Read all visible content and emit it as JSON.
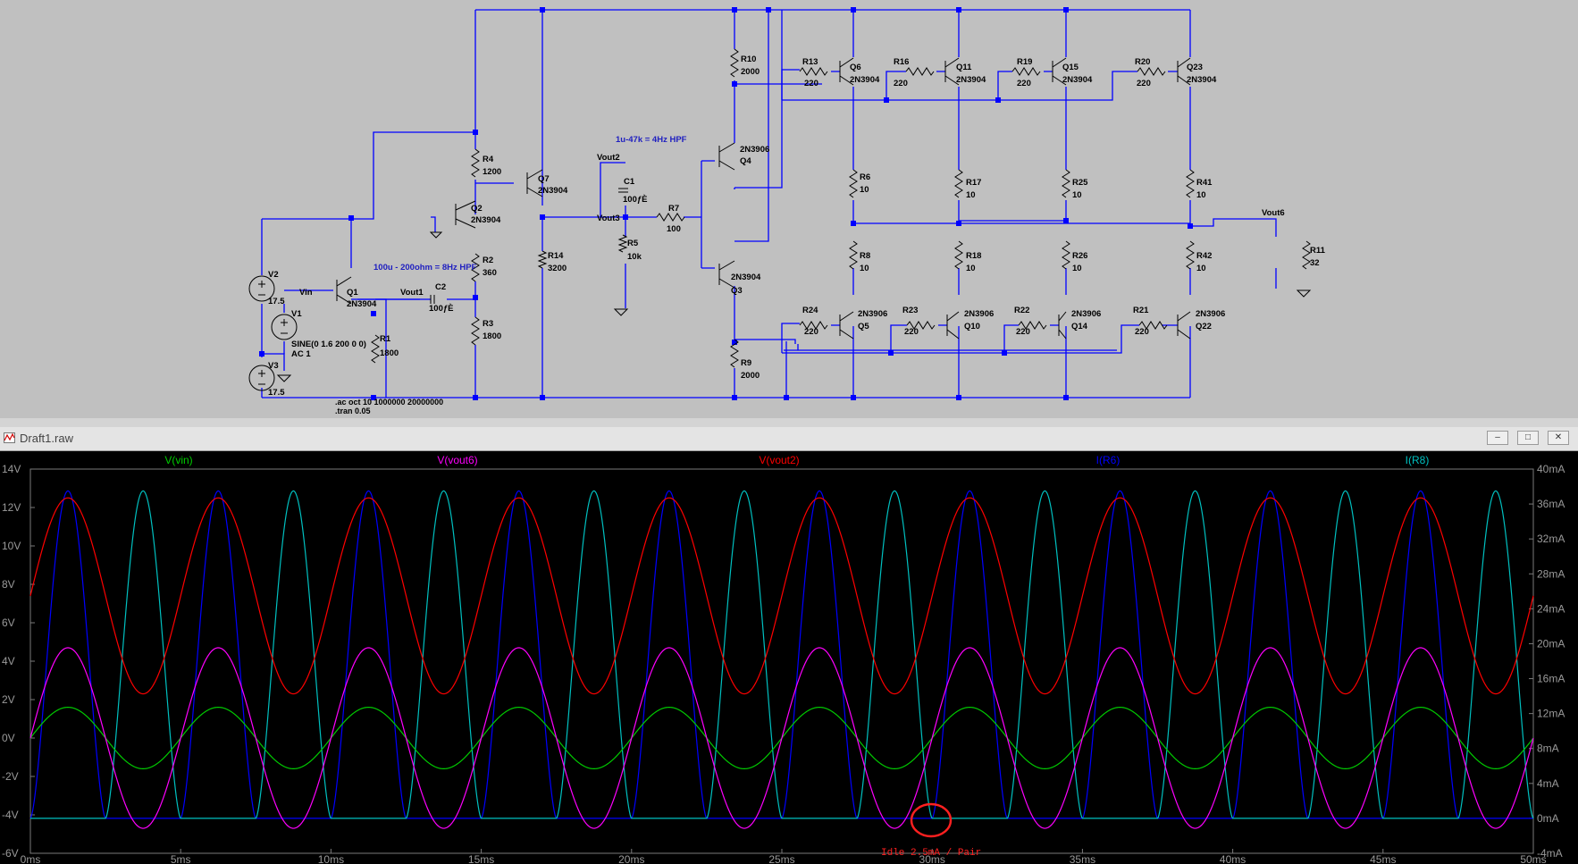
{
  "schematic": {
    "components": [
      {
        "ref": "V2",
        "value": "17.5"
      },
      {
        "ref": "V3",
        "value": "17.5"
      },
      {
        "ref": "V1",
        "value": "SINE(0 1.6 200 0 0)",
        "ac": "AC 1"
      },
      {
        "ref": "Q1",
        "value": "2N3904"
      },
      {
        "ref": "Q2",
        "value": "2N3904"
      },
      {
        "ref": "Q7",
        "value": "2N3904"
      },
      {
        "ref": "Q4",
        "value": "2N3906"
      },
      {
        "ref": "Q3",
        "value": "2N3904"
      },
      {
        "ref": "Q6",
        "value": "2N3904"
      },
      {
        "ref": "Q11",
        "value": "2N3904"
      },
      {
        "ref": "Q15",
        "value": "2N3904"
      },
      {
        "ref": "Q23",
        "value": "2N3904"
      },
      {
        "ref": "Q5",
        "value": "2N3906"
      },
      {
        "ref": "Q10",
        "value": "2N3906"
      },
      {
        "ref": "Q14",
        "value": "2N3906"
      },
      {
        "ref": "Q22",
        "value": "2N3906"
      },
      {
        "ref": "R1",
        "value": "1800"
      },
      {
        "ref": "R2",
        "value": "360"
      },
      {
        "ref": "R3",
        "value": "1800"
      },
      {
        "ref": "R4",
        "value": "1200"
      },
      {
        "ref": "R5",
        "value": "10k"
      },
      {
        "ref": "R7",
        "value": "100"
      },
      {
        "ref": "R14",
        "value": "3200"
      },
      {
        "ref": "R10",
        "value": "2000"
      },
      {
        "ref": "R9",
        "value": "2000"
      },
      {
        "ref": "R13",
        "value": "220"
      },
      {
        "ref": "R16",
        "value": "220"
      },
      {
        "ref": "R19",
        "value": "220"
      },
      {
        "ref": "R20",
        "value": "220"
      },
      {
        "ref": "R24",
        "value": "220"
      },
      {
        "ref": "R23",
        "value": "220"
      },
      {
        "ref": "R22",
        "value": "220"
      },
      {
        "ref": "R21",
        "value": "220"
      },
      {
        "ref": "R6",
        "value": "10"
      },
      {
        "ref": "R8",
        "value": "10"
      },
      {
        "ref": "R17",
        "value": "10"
      },
      {
        "ref": "R18",
        "value": "10"
      },
      {
        "ref": "R25",
        "value": "10"
      },
      {
        "ref": "R26",
        "value": "10"
      },
      {
        "ref": "R41",
        "value": "10"
      },
      {
        "ref": "R42",
        "value": "10"
      },
      {
        "ref": "R11",
        "value": "32"
      },
      {
        "ref": "C1",
        "value": "100ƒÈ"
      },
      {
        "ref": "C2",
        "value": "100ƒÈ"
      }
    ],
    "nets": {
      "vin": "Vin",
      "vout1": "Vout1",
      "vout2": "Vout2",
      "vout3": "Vout3",
      "vout6": "Vout6"
    },
    "notes": {
      "hpf2": "100u - 200ohm = 8Hz HPF",
      "hpf1": "1u-47k = 4Hz HPF"
    },
    "directives": {
      "ac": ".ac oct 10 1000000 20000000",
      "tran": ".tran 0.05"
    },
    "wire_color": "#0000ff"
  },
  "plot_window": {
    "title": "Draft1.raw",
    "buttons": {
      "minimize": "–",
      "maximize": "□",
      "close": "✕"
    },
    "traces": [
      {
        "label": "V(vin)",
        "color": "#00cc00"
      },
      {
        "label": "V(vout6)",
        "color": "#ff00ff"
      },
      {
        "label": "V(vout2)",
        "color": "#ff0000"
      },
      {
        "label": "I(R6)",
        "color": "#0000ff"
      },
      {
        "label": "I(R8)",
        "color": "#00c0c0"
      }
    ],
    "left_axis_ticks": [
      "14V",
      "12V",
      "10V",
      "8V",
      "6V",
      "4V",
      "2V",
      "0V",
      "-2V",
      "-4V",
      "-6V"
    ],
    "right_axis_ticks": [
      "40mA",
      "36mA",
      "32mA",
      "28mA",
      "24mA",
      "20mA",
      "16mA",
      "12mA",
      "8mA",
      "4mA",
      "0mA",
      "-4mA"
    ],
    "x_axis_ticks": [
      "0ms",
      "5ms",
      "10ms",
      "15ms",
      "20ms",
      "25ms",
      "30ms",
      "35ms",
      "40ms",
      "45ms",
      "50ms"
    ],
    "annotation": "Idle 2.5mA / Pair"
  },
  "chart_data": {
    "type": "line",
    "xlabel": "",
    "xlim": [
      0,
      50
    ],
    "ylim_left": [
      -6,
      14
    ],
    "ylim_right": [
      -4,
      40
    ],
    "frequency_hz": 200,
    "series": [
      {
        "name": "V(vin)",
        "axis": "left",
        "unit": "V",
        "offset": 0,
        "amplitude": 1.6,
        "phase_deg": 0
      },
      {
        "name": "V(vout6)",
        "axis": "left",
        "unit": "V",
        "offset": 0,
        "amplitude": 4.7,
        "phase_deg": 0
      },
      {
        "name": "V(vout2)",
        "axis": "left",
        "unit": "V",
        "offset": 7.4,
        "amplitude": 5.1,
        "phase_deg": 0
      },
      {
        "name": "I(R6)",
        "axis": "right",
        "unit": "mA",
        "peak": 37.5,
        "floor": 0,
        "phase_deg": 0
      },
      {
        "name": "I(R8)",
        "axis": "right",
        "unit": "mA",
        "peak": 37.5,
        "floor": 0,
        "phase_deg": 180
      }
    ]
  }
}
